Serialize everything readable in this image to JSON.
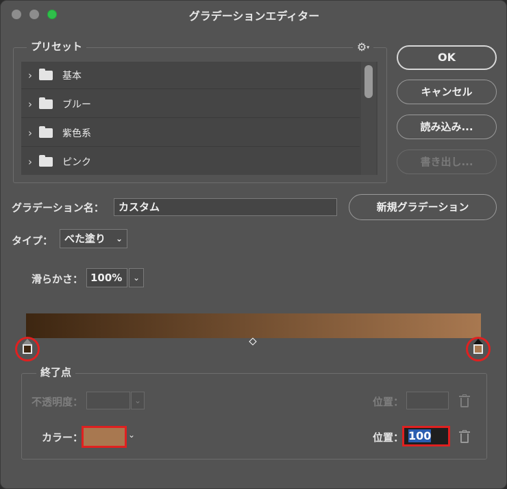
{
  "window": {
    "title": "グラデーションエディター"
  },
  "presets": {
    "legend": "プリセット",
    "gear_icon": "gear-icon",
    "items": [
      {
        "label": "基本"
      },
      {
        "label": "ブルー"
      },
      {
        "label": "紫色系"
      },
      {
        "label": "ピンク"
      }
    ]
  },
  "buttons": {
    "ok": "OK",
    "cancel": "キャンセル",
    "load": "読み込み...",
    "export": "書き出し..."
  },
  "gradient_name": {
    "label": "グラデーション名：",
    "value": "カスタム",
    "new_button": "新規グラデーション"
  },
  "type": {
    "label": "タイプ：",
    "value": "べた塗り"
  },
  "smoothness": {
    "label": "滑らかさ：",
    "value": "100%"
  },
  "gradient": {
    "start_color": "#3d2611",
    "end_color": "#a87850"
  },
  "endpoint": {
    "legend": "終了点",
    "opacity_label": "不透明度：",
    "opacity_position_label": "位置：",
    "color_label": "カラー：",
    "color_value": "#a87850",
    "color_position_label": "位置：",
    "color_position_value": "100"
  }
}
